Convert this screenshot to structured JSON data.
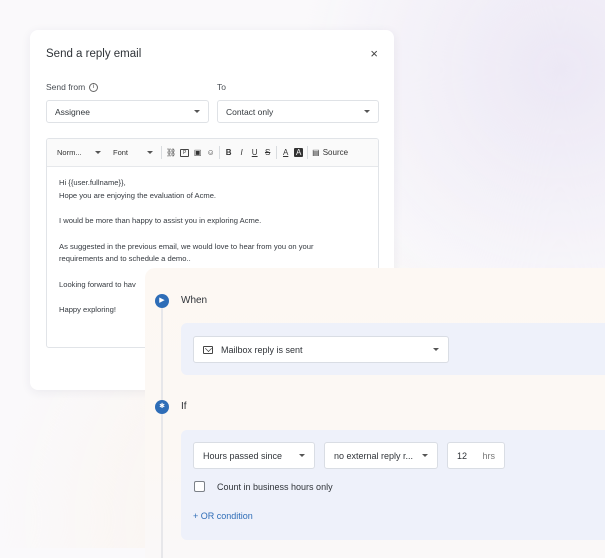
{
  "email": {
    "title": "Send a reply email",
    "close": "×",
    "send_from_label": "Send from",
    "send_from_value": "Assignee",
    "to_label": "To",
    "to_value": "Contact only",
    "toolbar": {
      "format": "Norm...",
      "font": "Font",
      "bold": "B",
      "italic": "I",
      "underline": "U",
      "strike": "S",
      "text_color": "A",
      "bg_color": "A",
      "source": "Source"
    },
    "body": [
      "Hi {{user.fullname}},",
      "Hope you are enjoying the evaluation of Acme.",
      "",
      "I would be more than happy to assist you in exploring Acme.",
      "",
      "As suggested in the previous email, we would love to hear from you on your",
      "requirements and to schedule a demo..",
      "",
      "Looking forward to hav",
      "",
      "Happy exploring!"
    ]
  },
  "workflow": {
    "when_label": "When",
    "when_value": "Mailbox reply is sent",
    "if_label": "If",
    "condition_field": "Hours passed since",
    "condition_op": "no external reply r...",
    "hours_value": "12",
    "hours_unit": "hrs",
    "business_hours_label": "Count in business hours only",
    "or_condition": "+ OR condition"
  },
  "colors": {
    "accent": "#2e6db7",
    "step_box": "#eef1fa"
  }
}
